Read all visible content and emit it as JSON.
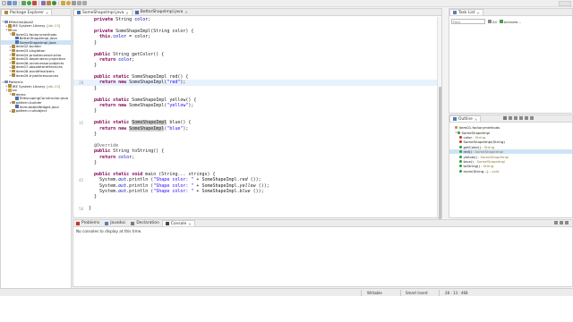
{
  "package_explorer": {
    "tab_label": "Package Explorer",
    "tree": [
      {
        "label": "EffectiveJava2",
        "indent": 0,
        "twisty": "▾",
        "icon": "project-icon",
        "color": "#6a8fc8"
      },
      {
        "label": "JRE System Library",
        "suffix": "[jdk-13]",
        "indent": 1,
        "twisty": "▸",
        "icon": "library-icon",
        "color": "#b58b3a"
      },
      {
        "label": "src",
        "indent": 1,
        "twisty": "▾",
        "icon": "source-folder-icon",
        "color": "#c9a74a"
      },
      {
        "label": "item01.factorymethods",
        "indent": 2,
        "twisty": "▾",
        "icon": "package-icon",
        "color": "#b08a3c"
      },
      {
        "label": "BetterShapeImpl.java",
        "indent": 3,
        "twisty": "",
        "icon": "java-file-icon",
        "color": "#4a6fb5"
      },
      {
        "label": "SomeShapeImpl.java",
        "indent": 3,
        "twisty": "",
        "icon": "java-file-icon",
        "color": "#4a6fb5",
        "selected": true
      },
      {
        "label": "item02.builder",
        "indent": 2,
        "twisty": "▸",
        "icon": "package-icon",
        "color": "#b08a3c"
      },
      {
        "label": "item03.singleton",
        "indent": 2,
        "twisty": "▸",
        "icon": "package-icon",
        "color": "#b08a3c"
      },
      {
        "label": "item04.privateconstructor",
        "indent": 2,
        "twisty": "▸",
        "icon": "package-icon",
        "color": "#b08a3c"
      },
      {
        "label": "item05.dependencyinjection",
        "indent": 2,
        "twisty": "▸",
        "icon": "package-icon",
        "color": "#b08a3c"
      },
      {
        "label": "item06.unnecessaryobjects",
        "indent": 2,
        "twisty": "▸",
        "icon": "package-icon",
        "color": "#b08a3c"
      },
      {
        "label": "item07.obsoletereferences",
        "indent": 2,
        "twisty": "▸",
        "icon": "package-icon",
        "color": "#b08a3c"
      },
      {
        "label": "item08.avoidfinalizers",
        "indent": 2,
        "twisty": "▸",
        "icon": "package-icon",
        "color": "#b08a3c"
      },
      {
        "label": "item09.trywithresources",
        "indent": 2,
        "twisty": "▸",
        "icon": "package-icon",
        "color": "#b08a3c"
      },
      {
        "label": "",
        "indent": 0,
        "twisty": "",
        "icon": "",
        "color": "",
        "spacer": true
      },
      {
        "label": "Patterns",
        "indent": 0,
        "twisty": "▾",
        "icon": "project-icon",
        "color": "#6a8fc8"
      },
      {
        "label": "JRE System Library",
        "suffix": "[jdk-13]",
        "indent": 1,
        "twisty": "▸",
        "icon": "library-icon",
        "color": "#b58b3a"
      },
      {
        "label": "src",
        "indent": 1,
        "twisty": "▾",
        "icon": "source-folder-icon",
        "color": "#c9a74a"
      },
      {
        "label": "demo",
        "indent": 2,
        "twisty": "▾",
        "icon": "package-icon",
        "color": "#b08a3c"
      },
      {
        "label": "TelescopingConstructor.java",
        "indent": 3,
        "twisty": "",
        "icon": "java-file-icon",
        "color": "#4a6fb5"
      },
      {
        "label": "pattern.builder",
        "indent": 2,
        "twisty": "▾",
        "icon": "package-icon",
        "color": "#b08a3c"
      },
      {
        "label": "ImmutableWidget.java",
        "indent": 3,
        "twisty": "",
        "icon": "java-file-icon",
        "color": "#4a6fb5"
      },
      {
        "label": "pattern.nullobject",
        "indent": 2,
        "twisty": "▸",
        "icon": "package-icon",
        "color": "#b08a3c"
      }
    ]
  },
  "editor": {
    "tabs": [
      {
        "label": "SomeShapeImpl.java",
        "active": true
      },
      {
        "label": "BetterShapeImpl.java",
        "active": false
      }
    ],
    "lines": [
      {
        "n": "",
        "html": "  <span class='kw'>private</span> String <span class='fd'>color</span>;"
      },
      {
        "n": "",
        "html": ""
      },
      {
        "n": "",
        "html": "  <span class='kw'>private</span> SomeShapeImpl(String color) {"
      },
      {
        "n": "",
        "html": "    <span class='kw'>this</span>.<span class='fd'>color</span> = color;"
      },
      {
        "n": "",
        "html": "  }"
      },
      {
        "n": "",
        "html": ""
      },
      {
        "n": "",
        "html": "  <span class='kw'>public</span> String getColor() {"
      },
      {
        "n": "",
        "html": "    <span class='kw'>return</span> <span class='fd'>color</span>;"
      },
      {
        "n": "",
        "html": "  }"
      },
      {
        "n": "",
        "html": ""
      },
      {
        "n": "",
        "html": "  <span class='kw'>public</span> <span class='kw'>static</span> SomeShapeImpl red() {"
      },
      {
        "n": "28",
        "html": "    <span class='kw'>return</span> <span class='kw'>new</span> SomeShapeImpl(<span class='st'>\"red\"</span>);",
        "hl": true
      },
      {
        "n": "",
        "html": "  }"
      },
      {
        "n": "",
        "html": ""
      },
      {
        "n": "",
        "html": "  <span class='kw'>public</span> <span class='kw'>static</span> SomeShapeImpl yellow() {"
      },
      {
        "n": "",
        "html": "    <span class='kw'>return</span> <span class='kw'>new</span> SomeShapeImpl(<span class='st'>\"yellow\"</span>);"
      },
      {
        "n": "",
        "html": "  }"
      },
      {
        "n": "",
        "html": ""
      },
      {
        "n": "35",
        "html": "  <span class='kw'>public</span> <span class='kw'>static</span> <span class='mk'>SomeShapeImpl</span> blue() {"
      },
      {
        "n": "",
        "html": "    <span class='kw'>return</span> <span class='kw'>new</span> <span class='mk'>SomeShapeImpl</span>(<span class='st'>\"blue\"</span>);"
      },
      {
        "n": "",
        "html": "  }"
      },
      {
        "n": "",
        "html": ""
      },
      {
        "n": "",
        "html": "  <span class='an'>@Override</span>"
      },
      {
        "n": "",
        "html": "  <span class='kw'>public</span> String toString() {"
      },
      {
        "n": "",
        "html": "    <span class='kw'>return</span> <span class='fd'>color</span>;"
      },
      {
        "n": "",
        "html": "  }"
      },
      {
        "n": "",
        "html": ""
      },
      {
        "n": "",
        "html": "  <span class='kw'>public</span> <span class='kw'>static</span> <span class='kw'>void</span> main (String... strings) {"
      },
      {
        "n": "45",
        "html": "    System.<span class='fd-it'>out</span>.println (<span class='st'>\"Shape color: \"</span> + SomeShapeImpl.<span class='it'>red</span> ());"
      },
      {
        "n": "",
        "html": "    System.<span class='fd-it'>out</span>.println (<span class='st'>\"Shape color: \"</span> + SomeShapeImpl.<span class='it'>yellow</span> ());"
      },
      {
        "n": "",
        "html": "    System.<span class='fd-it'>out</span>.println (<span class='st'>\"Shape color: \"</span> + SomeShapeImpl.<span class='it'>blue</span> ());"
      },
      {
        "n": "",
        "html": "  }"
      },
      {
        "n": "",
        "html": ""
      },
      {
        "n": "50",
        "html": "}"
      }
    ]
  },
  "task_list": {
    "tab_label": "Task List",
    "find_placeholder": "Find",
    "all_label": "All",
    "activate_label": "Activate..."
  },
  "outline": {
    "tab_label": "Outline",
    "items": [
      {
        "label": "item01.factorymethods",
        "indent": 0,
        "icon": "package-icon",
        "color": "#b08a3c"
      },
      {
        "label": "SomeShapeImpl",
        "indent": 0,
        "icon": "class-icon",
        "color": "#3f8a3f",
        "twisty": "▾"
      },
      {
        "label": "color",
        "type": ": String",
        "indent": 1,
        "icon": "private-field-icon",
        "color": "#c0392b"
      },
      {
        "label": "SomeShapeImpl(String)",
        "indent": 1,
        "icon": "constructor-icon",
        "color": "#c0392b"
      },
      {
        "label": "getColor()",
        "type": ": String",
        "indent": 1,
        "icon": "public-method-icon",
        "color": "#2e9e3a"
      },
      {
        "label": "red()",
        "type": ": SomeShapeImpl",
        "indent": 1,
        "icon": "static-method-icon",
        "color": "#2e9e3a",
        "selected": true
      },
      {
        "label": "yellow()",
        "type": ": SomeShapeImpl",
        "indent": 1,
        "icon": "static-method-icon",
        "color": "#2e9e3a"
      },
      {
        "label": "blue()",
        "type": ": SomeShapeImpl",
        "indent": 1,
        "icon": "static-method-icon",
        "color": "#2e9e3a"
      },
      {
        "label": "toString()",
        "type": ": String",
        "indent": 1,
        "icon": "public-method-icon",
        "color": "#2e9e3a"
      },
      {
        "label": "main(String...)",
        "type": ": void",
        "indent": 1,
        "icon": "static-method-icon",
        "color": "#2e9e3a"
      }
    ]
  },
  "console": {
    "tabs": [
      {
        "label": "Problems",
        "active": false
      },
      {
        "label": "Javadoc",
        "active": false
      },
      {
        "label": "Declaration",
        "active": false
      },
      {
        "label": "Console",
        "active": true
      }
    ],
    "message": "No consoles to display at this time."
  },
  "status_bar": {
    "mode": "Writable",
    "insert": "Smart Insert",
    "position": "28 : 13 : 468"
  }
}
